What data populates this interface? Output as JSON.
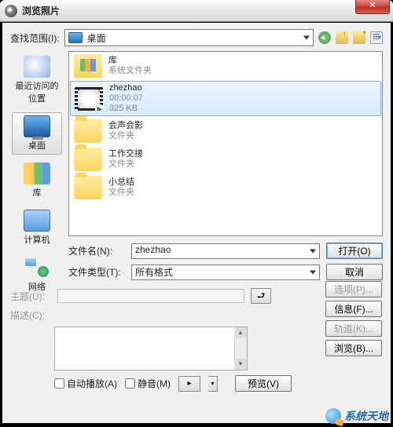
{
  "title": "浏览照片",
  "lookin": {
    "label": "查找范围(I):",
    "value": "桌面"
  },
  "places": {
    "recent": "最近访问的位置",
    "desktop": "桌面",
    "libraries": "库",
    "computer": "计算机",
    "network": "网络"
  },
  "files": [
    {
      "name": "库",
      "sub": "系统文件夹",
      "type": "lib"
    },
    {
      "name": "zhezhao",
      "sub1": "00:00:07",
      "sub2": "325 KB",
      "type": "video",
      "selected": true
    },
    {
      "name": "会声会影",
      "sub": "文件夹",
      "type": "folder"
    },
    {
      "name": "工作交接",
      "sub": "文件夹",
      "type": "folder"
    },
    {
      "name": "小总结",
      "sub": "文件夹",
      "type": "folder"
    }
  ],
  "filename": {
    "label": "文件名(N):",
    "value": "zhezhao"
  },
  "filetype": {
    "label": "文件类型(T):",
    "value": "所有格式"
  },
  "buttons": {
    "open": "打开(O)",
    "cancel": "取消",
    "options": "选项(P)...",
    "info": "信息(F)...",
    "track": "轨道(K)...",
    "browse": "浏览(B)...",
    "preview": "预览(V)"
  },
  "lower": {
    "subject": "主题(U):",
    "desc": "描述(C):",
    "autoplay": "自动播放(A)",
    "mute": "静音(M)"
  },
  "watermark": "系统天地"
}
